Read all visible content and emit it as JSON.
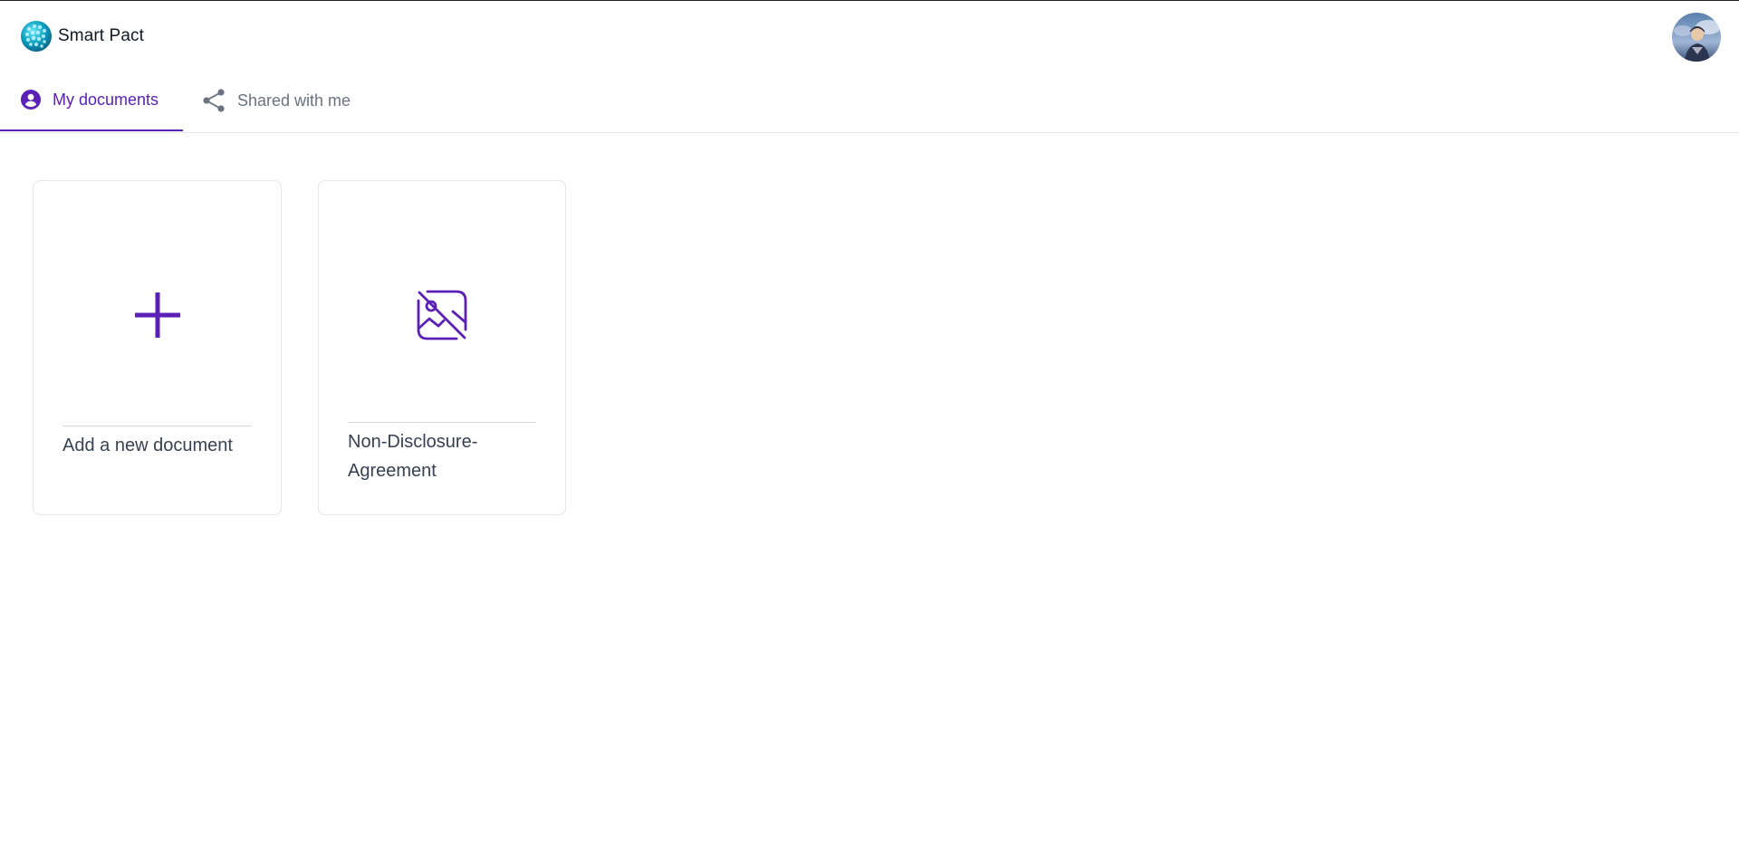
{
  "app": {
    "name": "Smart Pact"
  },
  "header": {
    "logo_icon": "globe-logo-icon",
    "avatar_icon": "user-avatar-icon"
  },
  "tabs": [
    {
      "label": "My documents",
      "icon": "user-circle-icon",
      "active": true
    },
    {
      "label": "Shared with me",
      "icon": "share-icon",
      "active": false
    }
  ],
  "documents": {
    "add_card": {
      "label": "Add a new document",
      "icon": "plus-icon"
    },
    "items": [
      {
        "title": "Non-Disclosure-Agreement",
        "thumbnail_icon": "image-off-icon"
      }
    ]
  },
  "colors": {
    "accent": "#5b21b6",
    "tab_inactive": "#6b7280",
    "border": "#e5e7eb",
    "text": "#374151"
  }
}
